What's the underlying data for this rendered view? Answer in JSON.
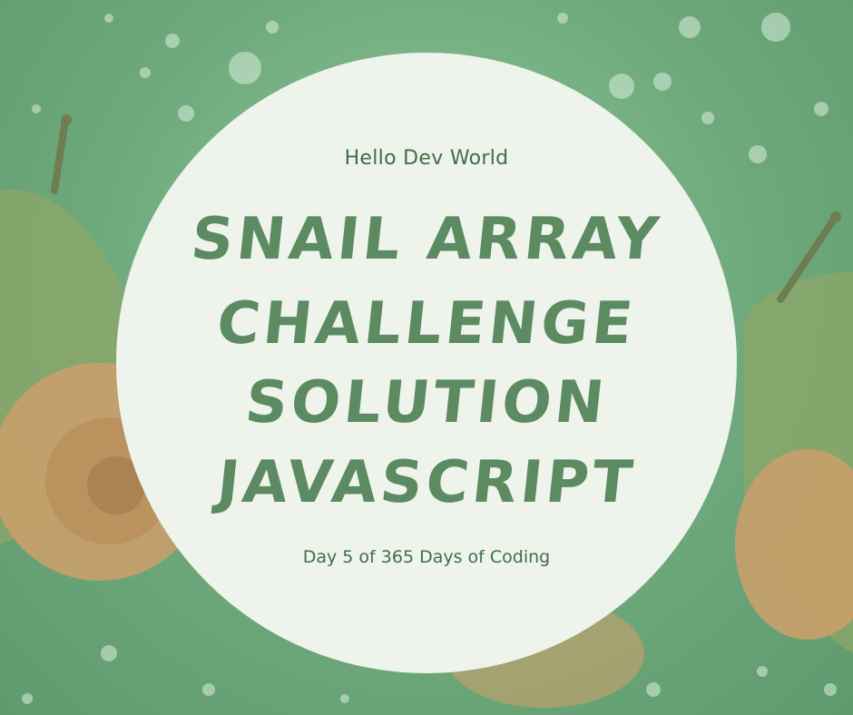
{
  "header": {
    "subtitle": "Hello Dev World"
  },
  "title": {
    "lines": [
      "SNAIL ARRAY",
      "CHALLENGE",
      "SOLUTION",
      "JAVASCRIPT"
    ]
  },
  "footer": {
    "text": "Day 5 of 365 Days of Coding"
  },
  "colors": {
    "background_green": "#6ea97c",
    "circle_fill": "#eef3ec",
    "title_green": "#5c8a61",
    "text_green": "#3f6f48",
    "snail_shell": "#c9a06a"
  }
}
